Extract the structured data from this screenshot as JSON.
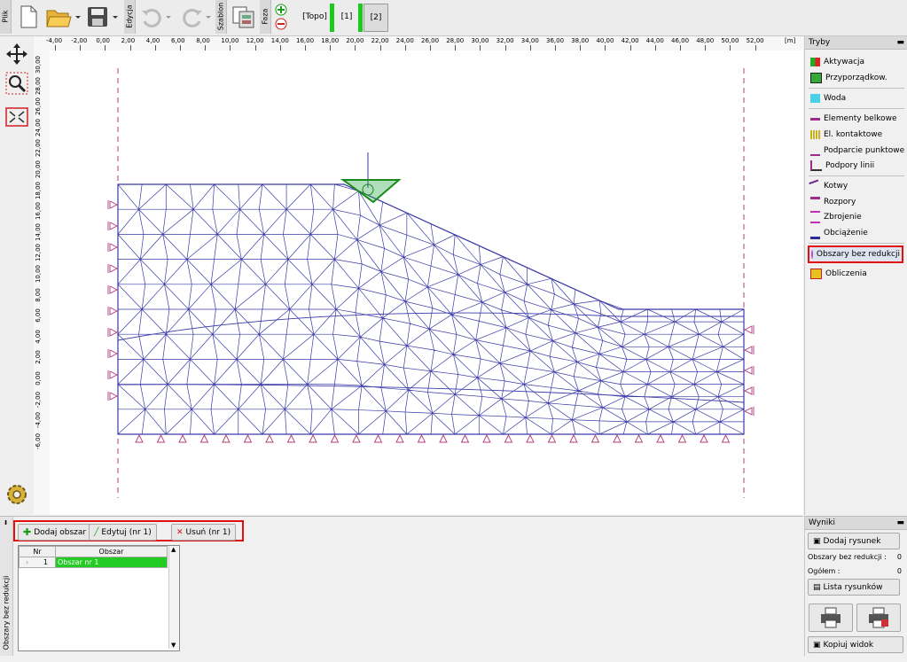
{
  "toolbar": {
    "file_tab": "Plik",
    "edit_tab": "Edycja",
    "template_tab": "Szablon",
    "phase_tab": "Faza",
    "phases": [
      "[Topo]",
      "[1]",
      "[2]"
    ]
  },
  "ruler": {
    "x_labels": [
      "-4,00",
      "-2,00",
      "0,00",
      "2,00",
      "4,00",
      "6,00",
      "8,00",
      "10,00",
      "12,00",
      "14,00",
      "16,00",
      "18,00",
      "20,00",
      "22,00",
      "24,00",
      "26,00",
      "28,00",
      "30,00",
      "32,00",
      "34,00",
      "36,00",
      "38,00",
      "40,00",
      "42,00",
      "44,00",
      "46,00",
      "48,00",
      "50,00",
      "52,00"
    ],
    "unit": "[m]",
    "y_labels": [
      "30,00",
      "28,00",
      "26,00",
      "24,00",
      "22,00",
      "20,00",
      "18,00",
      "16,00",
      "14,00",
      "12,00",
      "10,00",
      "8,00",
      "6,00",
      "4,00",
      "2,00",
      "0,00",
      "-2,00",
      "-4,00",
      "-6,00"
    ]
  },
  "right_panel": {
    "title": "Tryby",
    "items": [
      "Aktywacja",
      "Przyporządkow.",
      "Woda",
      "Elementy belkowe",
      "El. kontaktowe",
      "Podparcie punktowe",
      "Podpory linii",
      "Kotwy",
      "Rozpory",
      "Zbrojenie",
      "Obciążenie",
      "Obszary bez redukcji",
      "Obliczenia"
    ],
    "active": "Obszary bez redukcji"
  },
  "results_panel": {
    "title": "Wyniki",
    "add_drawing": "Dodaj rysunek",
    "areas_label": "Obszary bez redukcji :",
    "areas_value": "0",
    "total_label": "Ogółem :",
    "total_value": "0",
    "list_drawings": "Lista rysunków",
    "copy_view": "Kopiuj widok"
  },
  "bottom": {
    "side_label": "Obszary bez redukcji",
    "add_btn": "Dodaj obszar",
    "edit_btn": "Edytuj (nr 1)",
    "delete_btn": "Usuń (nr 1)",
    "table": {
      "headers": [
        "Nr",
        "Obszar"
      ],
      "rows": [
        {
          "nr": "1",
          "name": "Obszar nr 1"
        }
      ]
    }
  },
  "colors": {
    "mesh": "#3a3aa8",
    "support": "#b0387a",
    "accent_green": "#1ec81e",
    "highlight_red": "#e01010"
  }
}
